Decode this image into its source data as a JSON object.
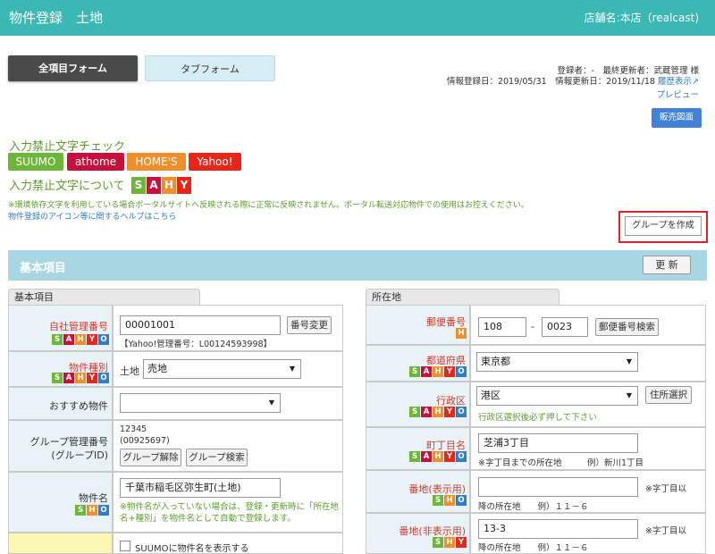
{
  "header": {
    "title": "物件登録　土地",
    "store": "店舗名:本店（realcast)"
  },
  "tabs": {
    "all_form": "全項目フォーム",
    "tab_form": "タブフォーム"
  },
  "meta": {
    "registrant": "登録者：-　最終更新者：武蔵管理 様",
    "dates": "情報登録日：2019/05/31　情報更新日：2019/11/18",
    "history_link": "履歴表示",
    "preview": "プレビュー"
  },
  "buttons": {
    "sale_map": "販売図面",
    "create_group": "グループを作成",
    "update": "更 新"
  },
  "check": {
    "title": "入力禁止文字チェック",
    "portals": [
      "SUUMO",
      "athome",
      "HOME'S",
      "Yahoo!"
    ],
    "about": "入力禁止文字について",
    "about_badges": [
      "S",
      "A",
      "H",
      "Y"
    ],
    "notice": "※環境依存文字を利用している場合ポータルサイトへ反映される際に正常に反映されません。ポータル転送対応物件での使用はお控えください。",
    "help_link": "物件登録のアイコン等に関するヘルプはこちら"
  },
  "colors": {
    "header": "#3bb8b4",
    "suumo": "#6eb63a",
    "athome": "#c8103f",
    "homes": "#ef8f2b",
    "yahoo": "#e7261b",
    "highlight": "#e1212d"
  },
  "section": {
    "title": "基本項目"
  },
  "left": {
    "tab": "基本項目",
    "mgmt_no_label": "自社管理番号",
    "mgmt_no_value": "00001001",
    "mgmt_no_button": "番号変更",
    "yahoo_no": "【Yahoo!管理番号：L00124593998】",
    "type_label": "物件種別",
    "type_prefix": "土地",
    "type_value": "売地",
    "recommend_label": "おすすめ物件",
    "recommend_value": "",
    "group_label_1": "グループ管理番号",
    "group_label_2": "(グループID)",
    "group_no": "12345",
    "group_id": "(00925697)",
    "group_release": "グループ解除",
    "group_search": "グループ検索",
    "name_label": "物件名",
    "name_value": "千葉市稲毛区弥生町(土地)",
    "name_note": "※物件名が入っていない場合は、登録・更新時に「所在地名+種別」を物件名として自動で登録します。",
    "suumo_check": "SUUMOに物件名を表示する"
  },
  "right": {
    "tab": "所在地",
    "zip_label": "郵便番号",
    "zip1": "108",
    "zip_dash": "-",
    "zip2": "0023",
    "zip_button": "郵便番号検索",
    "pref_label": "都道府県",
    "pref_value": "東京都",
    "ward_label": "行政区",
    "ward_value": "港区",
    "ward_button": "住所選択",
    "ward_note": "行政区選択後必ず押して下さい",
    "town_label": "町丁目名",
    "town_value": "芝浦3丁目",
    "town_note": "※字丁目までの所在地　　　例）新川1丁目",
    "lot_pub_label": "番地(表示用)",
    "lot_pub_value": "",
    "lot_pub_side": "※字丁目以",
    "lot_pub_note": "降の所在地　　例）１１－６",
    "lot_priv_label": "番地(非表示用)",
    "lot_priv_value": "13-3",
    "lot_priv_side": "※字丁目以",
    "lot_priv_note": "降の所在地　　例）１１－６"
  }
}
